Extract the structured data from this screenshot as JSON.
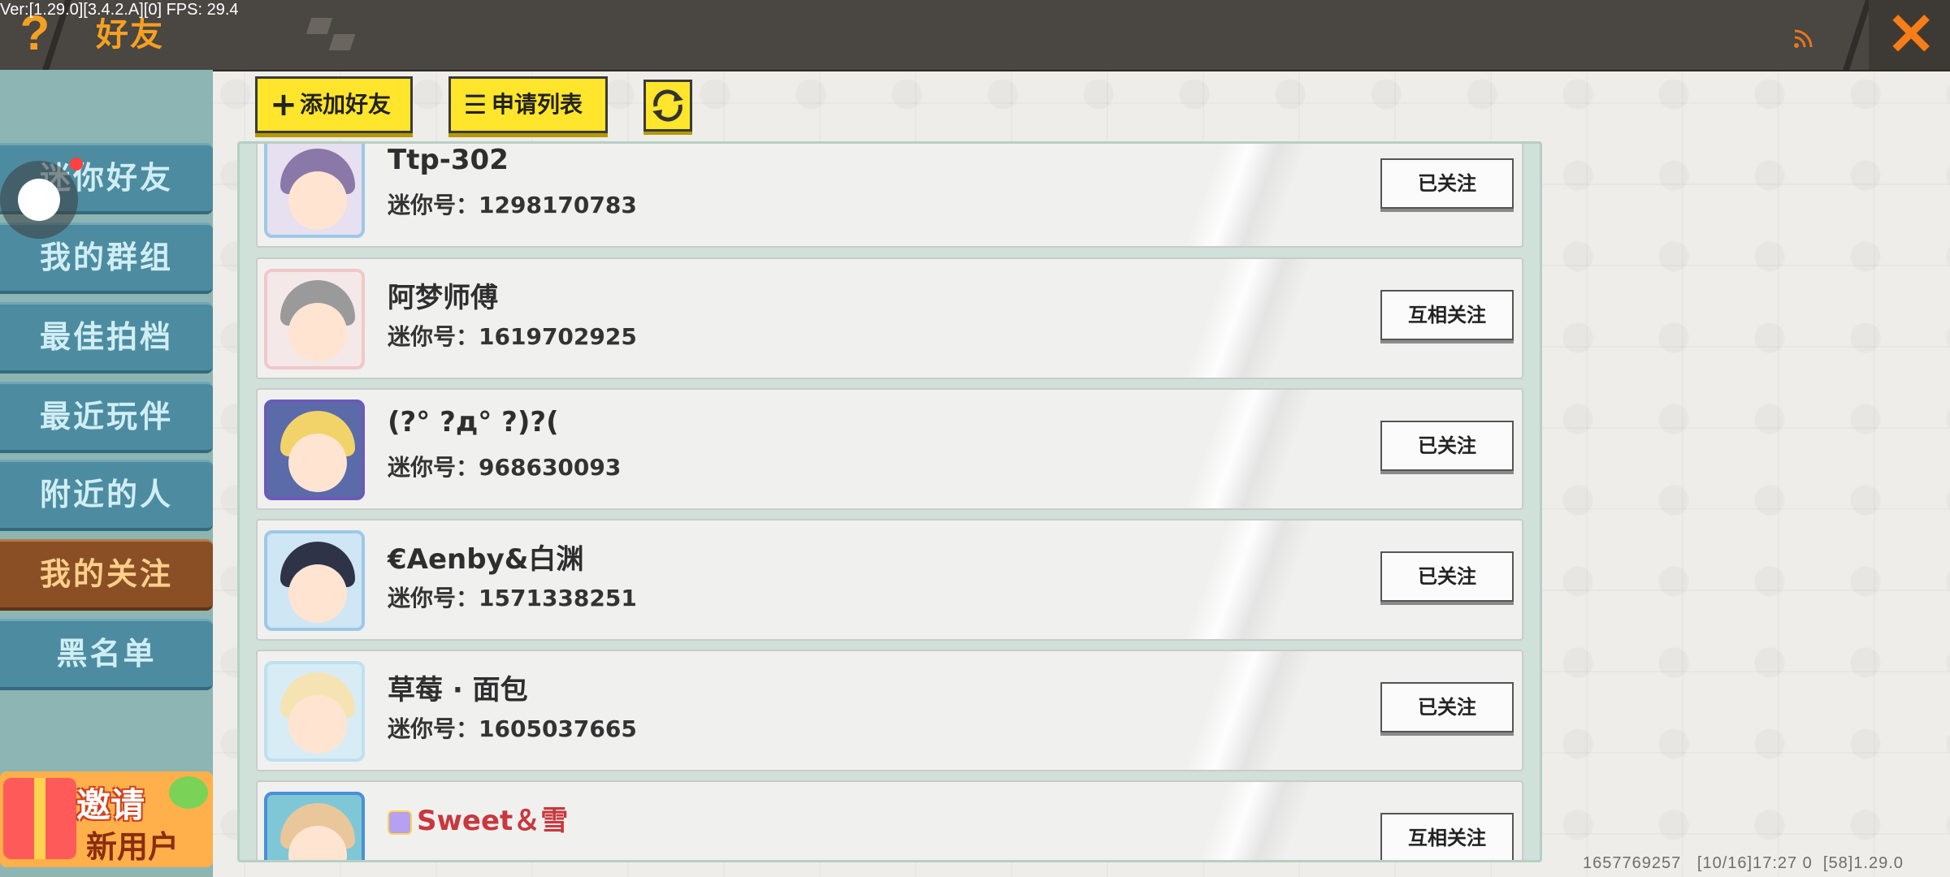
{
  "version_text": "Ver:[1.29.0][3.4.2.A][0] FPS: 29.4",
  "header": {
    "title": "好友",
    "help_glyph": "?",
    "close_glyph": "✕"
  },
  "sidebar": {
    "items": [
      {
        "label": "迷你好友",
        "active": false
      },
      {
        "label": "我的群组",
        "active": false
      },
      {
        "label": "最佳拍档",
        "active": false
      },
      {
        "label": "最近玩伴",
        "active": false
      },
      {
        "label": "附近的人",
        "active": false
      },
      {
        "label": "我的关注",
        "active": true
      },
      {
        "label": "黑名单",
        "active": false
      }
    ],
    "invite": {
      "line1": "邀请",
      "line2": "新用户"
    }
  },
  "toolbar": {
    "add_friend": "添加好友",
    "apply_list": "申请列表",
    "add_glyph": "+",
    "apply_glyph": "☰"
  },
  "id_prefix": "迷你号：",
  "friends": [
    {
      "name": "Ttp-302",
      "id": "1298170783",
      "status": "已关注",
      "hair": "#8a78a8",
      "bg": "#e6e0f0"
    },
    {
      "name": "阿梦师傅",
      "id": "1619702925",
      "status": "互相关注",
      "hair": "#9a9a9a",
      "bg": "#f4e8e8"
    },
    {
      "name": "(?° ?д° ?)?(",
      "id": "968630093",
      "status": "已关注",
      "hair": "#f2d36a",
      "bg": "#5b6aa8"
    },
    {
      "name": "€Aenby&白渊",
      "id": "1571338251",
      "status": "已关注",
      "hair": "#2e3348",
      "bg": "#cfe6f5"
    },
    {
      "name": "草莓 · 面包",
      "id": "1605037665",
      "status": "已关注",
      "hair": "#f6e3b4",
      "bg": "#d8ecf6"
    },
    {
      "name": "Sweet＆雪",
      "id": "",
      "status": "互相关注",
      "hair": "#e9c79a",
      "bg": "#7fc7d6",
      "vip": true
    }
  ],
  "footer": {
    "uin": "1657769257",
    "time": "[10/16]17:27 0",
    "ver": "[58]1.29.0"
  },
  "colors": {
    "accent_orange": "#f6a021",
    "tool_yellow": "#ffe52b",
    "sidebar_blue": "#4d8ba0",
    "sidebar_active": "#8a4f24"
  }
}
